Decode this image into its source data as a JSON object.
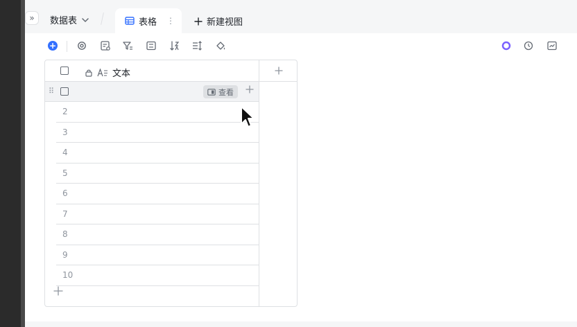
{
  "header": {
    "expand_symbol": "»",
    "datasheet_label": "数据表",
    "tab_label": "表格",
    "tab_more": "⋮",
    "new_view_label": "新建视图"
  },
  "grid": {
    "field_name": "文本",
    "view_label": "查看",
    "row_numbers": [
      "2",
      "3",
      "4",
      "5",
      "6",
      "7",
      "8",
      "9",
      "10"
    ]
  }
}
